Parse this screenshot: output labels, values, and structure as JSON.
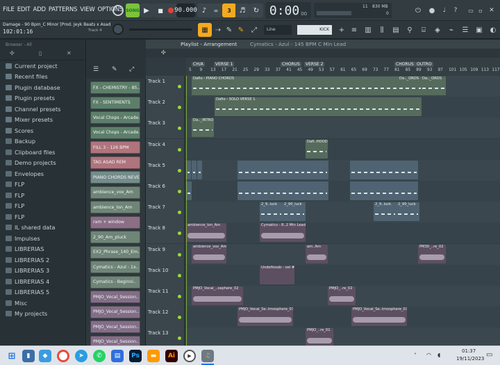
{
  "menu": [
    "FILE",
    "EDIT",
    "ADD",
    "PATTERNS",
    "VIEW",
    "OPTIONS",
    "TOOLS",
    "HELP"
  ],
  "transport": {
    "mode_label": "SONG",
    "tempo": "90.000",
    "time_main": "0:00",
    "time_sub": "00",
    "time_unit": "M:S:CS",
    "cpu_mb": "830 MB",
    "poly": "0",
    "cpu": "11"
  },
  "hint": {
    "line1": "Damage - 90 Bpm_C Minor [Prod. Jeyk Beats x Asad",
    "line2": "102:01:16",
    "track_hint": "Track 4"
  },
  "toolbar2": {
    "snap": "Line",
    "pattern": "KICK"
  },
  "browser": {
    "title": "Browser - All",
    "items": [
      {
        "label": "Current project",
        "icon": "project-icon"
      },
      {
        "label": "Recent files",
        "icon": "recent-icon"
      },
      {
        "label": "Plugin database",
        "icon": "plugin-db-icon"
      },
      {
        "label": "Plugin presets",
        "icon": "plugin-presets-icon"
      },
      {
        "label": "Channel presets",
        "icon": "channel-presets-icon"
      },
      {
        "label": "Mixer presets",
        "icon": "mixer-presets-icon"
      },
      {
        "label": "Scores",
        "icon": "scores-icon"
      },
      {
        "label": "Backup",
        "icon": "folder-icon"
      },
      {
        "label": "Clipboard files",
        "icon": "folder-icon"
      },
      {
        "label": "Demo projects",
        "icon": "folder-icon"
      },
      {
        "label": "Envelopes",
        "icon": "folder-icon"
      },
      {
        "label": "FLP",
        "icon": "folder-icon"
      },
      {
        "label": "FLP",
        "icon": "folder-icon"
      },
      {
        "label": "FLP",
        "icon": "folder-icon"
      },
      {
        "label": "FLP",
        "icon": "folder-icon"
      },
      {
        "label": "IL shared data",
        "icon": "folder-icon"
      },
      {
        "label": "Impulses",
        "icon": "folder-icon"
      },
      {
        "label": "LIBRERIAS",
        "icon": "folder-icon"
      },
      {
        "label": "LIBRERIAS 2",
        "icon": "folder-icon"
      },
      {
        "label": "LIBRERIAS 3",
        "icon": "folder-icon"
      },
      {
        "label": "LIBRERIAS 4",
        "icon": "folder-icon"
      },
      {
        "label": "LIBRERIAS 5",
        "icon": "folder-icon"
      },
      {
        "label": "Misc",
        "icon": "folder-icon"
      },
      {
        "label": "My projects",
        "icon": "folder-icon"
      }
    ]
  },
  "rack": {
    "channels": [
      {
        "label": "FX - CHEMISTRY - 85..",
        "color": "#5d7f6a"
      },
      {
        "label": "FX - SENTIMENTS",
        "color": "#5d7f6a"
      },
      {
        "label": "Vocal Chops - Arcade..",
        "color": "#5d7f6a"
      },
      {
        "label": "Vocal Chops - Arcade..",
        "color": "#5d7f6a"
      },
      {
        "label": "FILL 3 - 126 BPM",
        "color": "#b0747d"
      },
      {
        "label": "TAG ASAD REM",
        "color": "#b0747d"
      },
      {
        "label": "PIANO CHORDS NEVER..",
        "color": "#748c8a"
      },
      {
        "label": "ambience_vox_Am",
        "color": "#6f8577"
      },
      {
        "label": "ambience_lon_Am",
        "color": "#6f8577"
      },
      {
        "label": "ram + window",
        "color": "#8a6f85"
      },
      {
        "label": "2_90_Am_pluck",
        "color": "#6f8577"
      },
      {
        "label": "EX2_Phrase_140_Em..",
        "color": "#6f8577"
      },
      {
        "label": "Cymatics - Azul - 1x..",
        "color": "#6f8577"
      },
      {
        "label": "Cymatics - Beginni..",
        "color": "#6f8577"
      },
      {
        "label": "PMJO_Vocal_Session..",
        "color": "#836e87"
      },
      {
        "label": "PMJO_Vocal_Session..",
        "color": "#836e87"
      },
      {
        "label": "PMJO_Vocal_Session..",
        "color": "#836e87"
      },
      {
        "label": "PMJO_Vocal_Session..",
        "color": "#836e87"
      }
    ]
  },
  "playlist": {
    "title": "Playlist - Arrangement",
    "pattern": "Cymatics - Azul - 145 BPM C Min Lead",
    "bars": [
      "5",
      "9",
      "13",
      "17",
      "21",
      "25",
      "29",
      "33",
      "37",
      "41",
      "45",
      "49",
      "53",
      "57",
      "61",
      "65",
      "69",
      "73",
      "77",
      "81",
      "85",
      "89",
      "93",
      "97",
      "101",
      "105",
      "109",
      "113",
      "117"
    ],
    "markers": [
      "CH/A",
      "VERSE 1",
      "CHORUS",
      "VERSE 2",
      "CHORUS",
      "OUTRO"
    ],
    "tracks": [
      "Track 1",
      "Track 2",
      "Track 3",
      "Track 4",
      "Track 5",
      "Track 6",
      "Track 7",
      "Track 8",
      "Track 9",
      "Track 10",
      "Track 11",
      "Track 12",
      "Track 13"
    ],
    "clip_labels": {
      "t1a": "Dafio - PIANO CHORDS",
      "t1b": "Da.._ORDS",
      "t1c": "Da.._ORDS",
      "t2a": "Dafio - SOLO VERSE 1",
      "t3a": "Da.._INTRO",
      "t4a": "Dafi..HOOD",
      "t7a": "2_9..luck",
      "t7b": "2_90_luck",
      "t7c": "2_9..luck",
      "t7d": "2_90_luck",
      "t8a": "ambience_lon_Am",
      "t8b": "Cymatics - 8..2 Min Lead",
      "t9a": "ambience_vox_Am",
      "t9b": "am..Am",
      "t9c": "PM30_..re_02",
      "t10a": "Undefinsob - vel #2",
      "t11a": "PMJO_Vocal_..osphere_02",
      "t11b": "PMJO_..re_02",
      "t12a": "PMJO_Vocal_Se..tmosphere_03",
      "t12b": "PMJO_Vocal_Se..tmosphere_03",
      "t13a": "PMJO_..re_01"
    }
  },
  "taskbar": {
    "time": "01:37",
    "date": "19/11/2023"
  },
  "colors": {
    "accent": "#f4a91f",
    "green_led": "#9adb3a",
    "clip_green": "#566b5c",
    "clip_audio": "#5c4f61",
    "clip_pattern": "#4f6372"
  }
}
